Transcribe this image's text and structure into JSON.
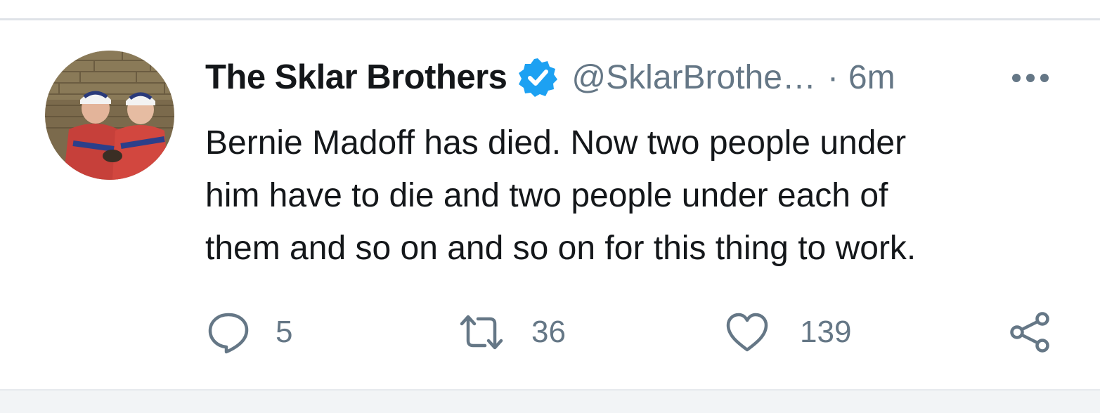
{
  "tweet": {
    "author": {
      "display_name": "The Sklar Brothers",
      "verified": true,
      "handle": "@SklarBrothe…",
      "avatar_icon": "avatar-photo"
    },
    "separator": "·",
    "time": "6m",
    "more_icon": "more-horizontal-icon",
    "text": "Bernie Madoff has died.  Now two people under\nhim have to die and two people under each of\nthem and so on and so on for this thing to work.",
    "actions": {
      "reply": {
        "icon": "reply-icon",
        "count": "5"
      },
      "retweet": {
        "icon": "retweet-icon",
        "count": "36"
      },
      "like": {
        "icon": "like-heart-icon",
        "count": "139"
      },
      "share": {
        "icon": "share-icon"
      }
    }
  },
  "colors": {
    "text_primary": "#14171a",
    "text_secondary": "#657786",
    "verified_blue": "#1da1f2",
    "divider": "#dfe3e8"
  }
}
